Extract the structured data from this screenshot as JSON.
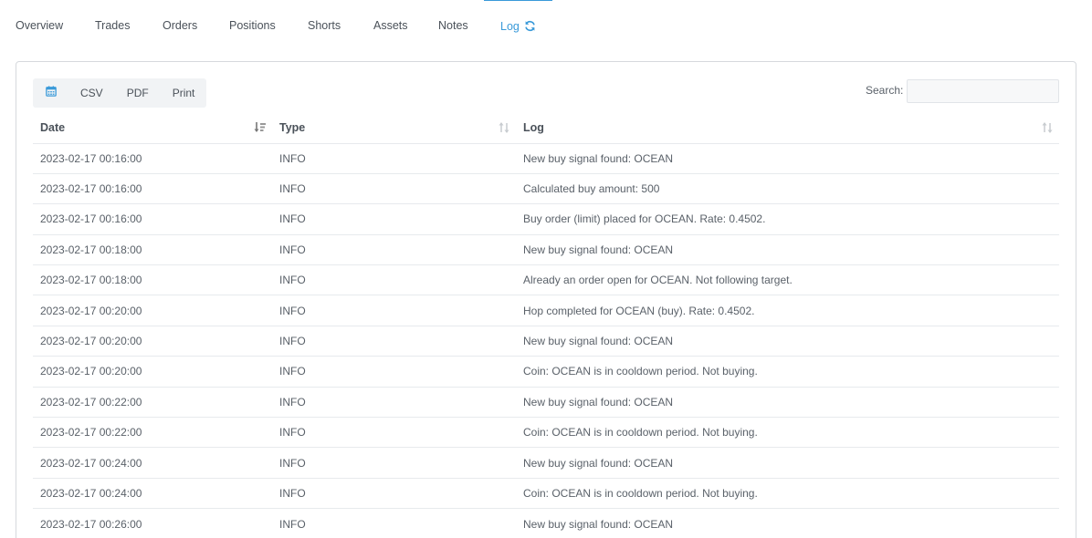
{
  "tabs": [
    {
      "label": "Overview"
    },
    {
      "label": "Trades"
    },
    {
      "label": "Orders"
    },
    {
      "label": "Positions"
    },
    {
      "label": "Shorts"
    },
    {
      "label": "Assets"
    },
    {
      "label": "Notes"
    },
    {
      "label": "Log",
      "active": true
    }
  ],
  "toolbar": {
    "calendar_icon": "calendar-icon",
    "csv_label": "CSV",
    "pdf_label": "PDF",
    "print_label": "Print"
  },
  "search": {
    "label": "Search:",
    "value": "",
    "placeholder": ""
  },
  "table": {
    "columns": [
      "Date",
      "Type",
      "Log"
    ],
    "rows": [
      [
        "2023-02-17 00:16:00",
        "INFO",
        "New buy signal found: OCEAN"
      ],
      [
        "2023-02-17 00:16:00",
        "INFO",
        "Calculated buy amount: 500"
      ],
      [
        "2023-02-17 00:16:00",
        "INFO",
        "Buy order (limit) placed for OCEAN. Rate: 0.4502."
      ],
      [
        "2023-02-17 00:18:00",
        "INFO",
        "New buy signal found: OCEAN"
      ],
      [
        "2023-02-17 00:18:00",
        "INFO",
        "Already an order open for OCEAN. Not following target."
      ],
      [
        "2023-02-17 00:20:00",
        "INFO",
        "Hop completed for OCEAN (buy). Rate: 0.4502."
      ],
      [
        "2023-02-17 00:20:00",
        "INFO",
        "New buy signal found: OCEAN"
      ],
      [
        "2023-02-17 00:20:00",
        "INFO",
        "Coin: OCEAN is in cooldown period. Not buying."
      ],
      [
        "2023-02-17 00:22:00",
        "INFO",
        "New buy signal found: OCEAN"
      ],
      [
        "2023-02-17 00:22:00",
        "INFO",
        "Coin: OCEAN is in cooldown period. Not buying."
      ],
      [
        "2023-02-17 00:24:00",
        "INFO",
        "New buy signal found: OCEAN"
      ],
      [
        "2023-02-17 00:24:00",
        "INFO",
        "Coin: OCEAN is in cooldown period. Not buying."
      ],
      [
        "2023-02-17 00:26:00",
        "INFO",
        "New buy signal found: OCEAN"
      ]
    ]
  },
  "colors": {
    "accent": "#3a9ad9",
    "border": "#d6d9dd"
  }
}
